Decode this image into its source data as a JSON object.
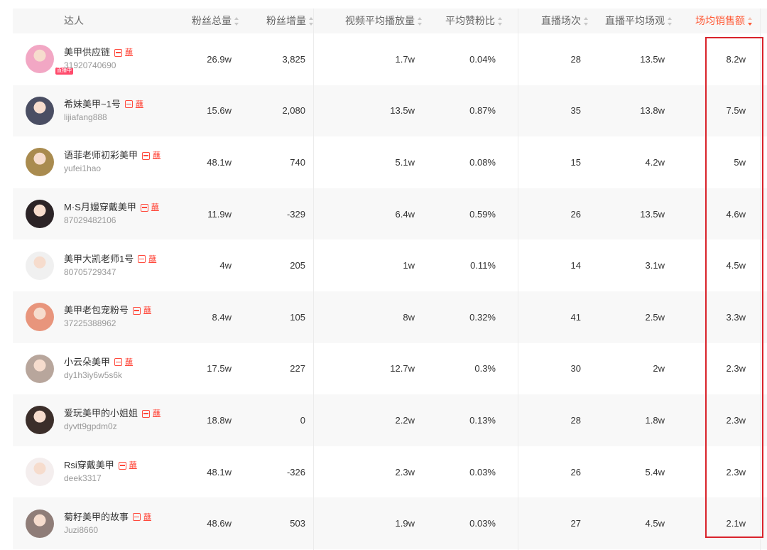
{
  "columns": {
    "creator": "达人",
    "fans_total": "粉丝总量",
    "fans_growth": "粉丝增量",
    "video_avg_play": "视频平均播放量",
    "avg_like_ratio": "平均赞粉比",
    "live_count": "直播场次",
    "live_avg_view": "直播平均场观",
    "avg_sales": "场均销售额"
  },
  "sorted_column": "avg_sales",
  "accent_color": "#ff5a36",
  "highlight_color": "#d9232b",
  "rows": [
    {
      "name": "美甲供应链",
      "uid": "31920740690",
      "live_tag": "直播中",
      "tag_char": "蘸",
      "avatar_color": "#f2a7c4",
      "fans_total": "26.9w",
      "fans_growth": "3,825",
      "video_avg_play": "1.7w",
      "avg_like_ratio": "0.04%",
      "live_count": "28",
      "live_avg_view": "13.5w",
      "avg_sales": "8.2w"
    },
    {
      "name": "希妹美甲~1号",
      "uid": "lijiafang888",
      "tag_char": "蘸",
      "avatar_color": "#4a4e63",
      "fans_total": "15.6w",
      "fans_growth": "2,080",
      "video_avg_play": "13.5w",
      "avg_like_ratio": "0.87%",
      "live_count": "35",
      "live_avg_view": "13.8w",
      "avg_sales": "7.5w"
    },
    {
      "name": "语菲老师初彩美甲",
      "uid": "yufei1hao",
      "tag_char": "蘸",
      "avatar_color": "#a98b4f",
      "fans_total": "48.1w",
      "fans_growth": "740",
      "video_avg_play": "5.1w",
      "avg_like_ratio": "0.08%",
      "live_count": "15",
      "live_avg_view": "4.2w",
      "avg_sales": "5w"
    },
    {
      "name": "M·S月嫚穿戴美甲",
      "uid": "87029482106",
      "tag_char": "蘸",
      "avatar_color": "#2b2326",
      "fans_total": "11.9w",
      "fans_growth": "-329",
      "video_avg_play": "6.4w",
      "avg_like_ratio": "0.59%",
      "live_count": "26",
      "live_avg_view": "13.5w",
      "avg_sales": "4.6w"
    },
    {
      "name": "美甲大凯老师1号",
      "uid": "80705729347",
      "tag_char": "蘸",
      "avatar_color": "#f0f0f0",
      "fans_total": "4w",
      "fans_growth": "205",
      "video_avg_play": "1w",
      "avg_like_ratio": "0.11%",
      "live_count": "14",
      "live_avg_view": "3.1w",
      "avg_sales": "4.5w"
    },
    {
      "name": "美甲老包宠粉号",
      "uid": "37225388962",
      "tag_char": "蘸",
      "avatar_color": "#e8957c",
      "fans_total": "8.4w",
      "fans_growth": "105",
      "video_avg_play": "8w",
      "avg_like_ratio": "0.32%",
      "live_count": "41",
      "live_avg_view": "2.5w",
      "avg_sales": "3.3w"
    },
    {
      "name": "小云朵美甲",
      "uid": "dy1h3iy6w5s6k",
      "tag_char": "蘸",
      "avatar_color": "#b8a69c",
      "fans_total": "17.5w",
      "fans_growth": "227",
      "video_avg_play": "12.7w",
      "avg_like_ratio": "0.3%",
      "live_count": "30",
      "live_avg_view": "2w",
      "avg_sales": "2.3w"
    },
    {
      "name": "爱玩美甲的小姐姐",
      "uid": "dyvtt9gpdm0z",
      "tag_char": "蘸",
      "avatar_color": "#3b2e2a",
      "fans_total": "18.8w",
      "fans_growth": "0",
      "video_avg_play": "2.2w",
      "avg_like_ratio": "0.13%",
      "live_count": "28",
      "live_avg_view": "1.8w",
      "avg_sales": "2.3w"
    },
    {
      "name": "Rsi穿戴美甲",
      "uid": "deek3317",
      "tag_char": "蘸",
      "avatar_color": "#f4eeee",
      "fans_total": "48.1w",
      "fans_growth": "-326",
      "video_avg_play": "2.3w",
      "avg_like_ratio": "0.03%",
      "live_count": "26",
      "live_avg_view": "5.4w",
      "avg_sales": "2.3w"
    },
    {
      "name": "菊籽美甲的故事",
      "uid": "Juzi8660",
      "tag_char": "蘸",
      "avatar_color": "#8f7d78",
      "fans_total": "48.6w",
      "fans_growth": "503",
      "video_avg_play": "1.9w",
      "avg_like_ratio": "0.03%",
      "live_count": "27",
      "live_avg_view": "4.5w",
      "avg_sales": "2.1w"
    }
  ]
}
